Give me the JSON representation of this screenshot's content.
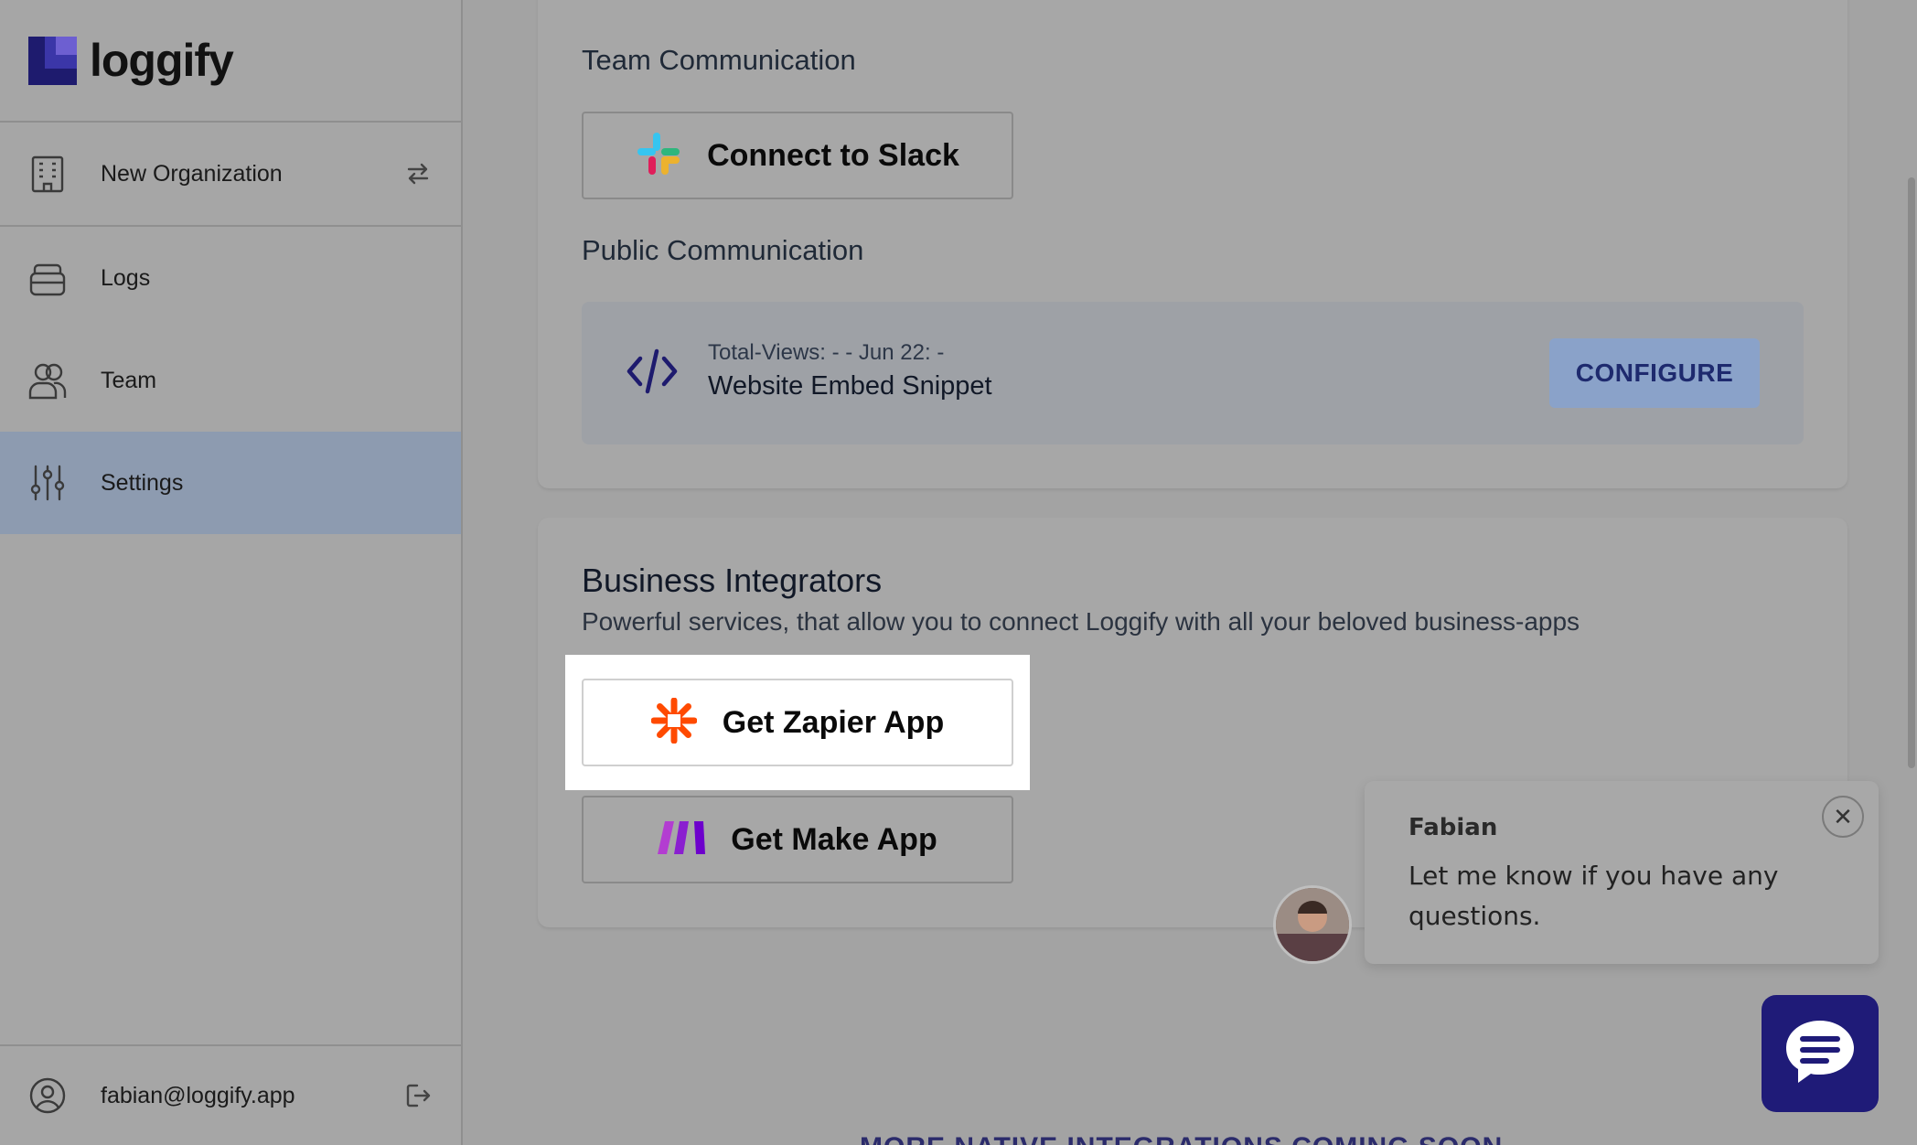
{
  "brand": {
    "name": "loggify"
  },
  "sidebar": {
    "organization": "New Organization",
    "items": [
      {
        "label": "Logs",
        "icon": "inbox-icon"
      },
      {
        "label": "Team",
        "icon": "users-icon"
      },
      {
        "label": "Settings",
        "icon": "sliders-icon",
        "active": true
      }
    ],
    "user_email": "fabian@loggify.app"
  },
  "team_comm": {
    "title": "Team Communication",
    "slack_label": "Connect to Slack"
  },
  "public_comm": {
    "title": "Public Communication",
    "embed_meta": "Total-Views: - - Jun 22: -",
    "embed_name": "Website Embed Snippet",
    "configure_label": "CONFIGURE"
  },
  "business": {
    "title": "Business Integrators",
    "subtitle": "Powerful services, that allow you to connect Loggify with all your beloved business-apps",
    "zapier_label": "Get Zapier App",
    "make_label": "Get Make App",
    "coming_soon": "MORE NATIVE INTEGRATIONS COMING SOON"
  },
  "chat": {
    "agent_name": "Fabian",
    "message": "Let me know if you have any questions.",
    "close_symbol": "✕"
  },
  "colors": {
    "accent": "#1f1b78",
    "zapier": "#ff4a00",
    "make": "#6d00cc"
  }
}
